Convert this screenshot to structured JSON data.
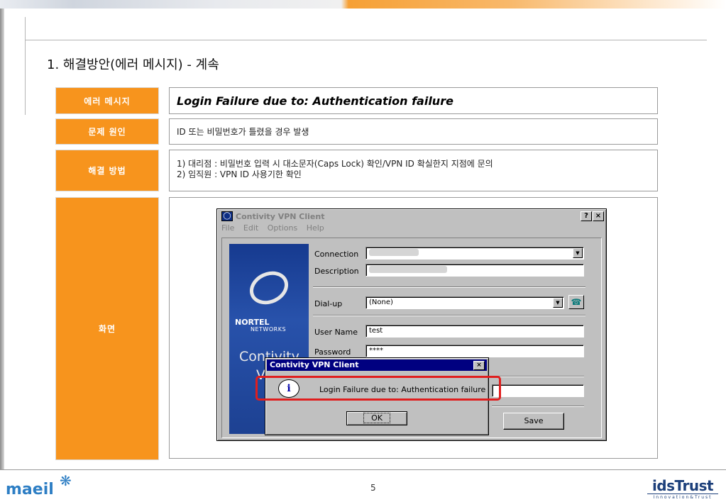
{
  "title": "1. 해결방안(에러 메시지) - 계속",
  "rows": [
    {
      "label": "에러 메시지",
      "content": "Login  Failure due to: Authentication failure"
    },
    {
      "label": "문제 원인",
      "content": "ID 또는 비밀번호가 틀렸을 경우 발생"
    },
    {
      "label": "해결 방법",
      "lines": [
        "1) 대리점 : 비밀번호 입력 시 대소문자(Caps Lock) 확인/VPN ID 확실한지 지점에 문의",
        "2) 임직원 : VPN ID 사용기한 확인"
      ]
    },
    {
      "label": "화면"
    }
  ],
  "vpn": {
    "window_title": "Contivity VPN Client",
    "help_btn": "?",
    "close_btn": "×",
    "menu": [
      "File",
      "Edit",
      "Options",
      "Help"
    ],
    "brand_nortel": "NORTEL",
    "brand_networks": "NETWORKS",
    "brand_contivity": "Contivity",
    "brand_vpn_fragment": "VP",
    "fields": {
      "connection_label": "Connection",
      "description_label": "Description",
      "dialup_label": "Dial-up",
      "dialup_value": "(None)",
      "username_label": "User Name",
      "username_value": "test",
      "password_label": "Password",
      "password_value": "****"
    },
    "save_btn": "Save"
  },
  "dialog": {
    "title": "Contivity VPN Client",
    "close_btn": "×",
    "icon": "i",
    "message": "Login Failure due to: Authentication failure",
    "ok_btn": "OK"
  },
  "footer": {
    "left_logo": "maeil",
    "page_number": "5",
    "right_logo": "idsTrust",
    "right_tagline": "Innovation&Trust"
  },
  "colors": {
    "accent": "#f7941d",
    "highlight": "#e01e1e",
    "dialog_title_bar": "#000080"
  }
}
